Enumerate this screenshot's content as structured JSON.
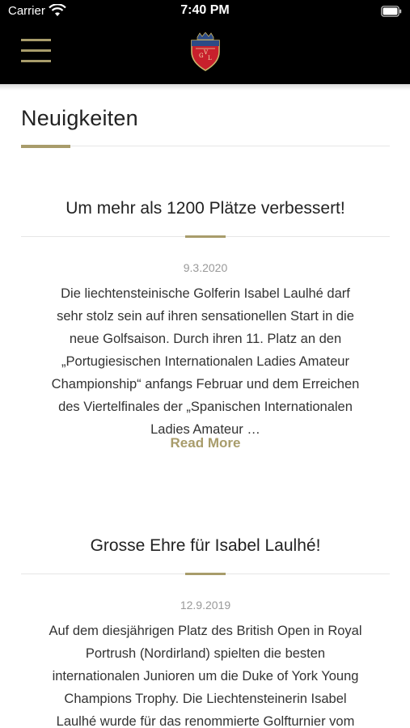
{
  "status_bar": {
    "carrier": "Carrier",
    "time": "7:40 PM"
  },
  "header": {
    "menu_icon": "hamburger-menu-icon",
    "logo_icon": "club-crest-logo",
    "logo_letters": "G V L",
    "accent_color": "#a89c6b",
    "background_color": "#000000"
  },
  "page": {
    "title": "Neuigkeiten"
  },
  "articles": [
    {
      "title": "Um mehr als 1200 Plätze verbessert!",
      "date": "9.3.2020",
      "lines": [
        "Die liechtensteinische Golferin Isabel Laulhé darf",
        "sehr stolz sein auf ihren sensationellen Start in die",
        "neue Golfsaison. Durch ihren 11. Platz an den",
        "„Portugiesischen Internationalen Ladies Amateur",
        "Championship“ anfangs Februar und dem Erreichen",
        "des Viertelfinales der „Spanischen Internationalen",
        "Ladies Amateur …"
      ],
      "read_more": "Read More"
    },
    {
      "title": "Grosse Ehre für Isabel Laulhé!",
      "date": "12.9.2019",
      "lines": [
        "Auf dem diesjährigen Platz des British Open in Royal",
        "Portrush (Nordirland) spielten die besten",
        "internationalen Junioren um die Duke of York Young",
        "Champions Trophy. Die Liechtensteinerin Isabel",
        "Laulhé wurde für das renommierte Golfturnier vom"
      ]
    }
  ]
}
